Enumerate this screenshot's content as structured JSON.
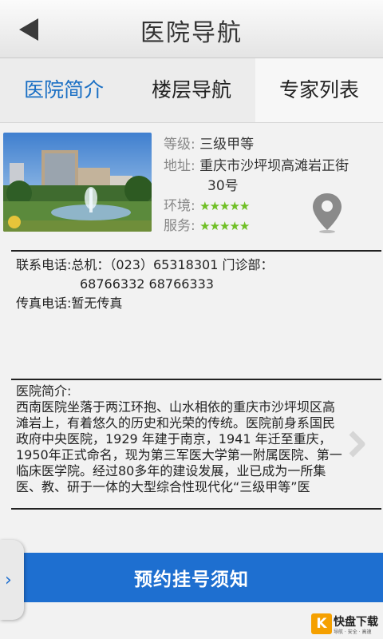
{
  "header": {
    "title": "医院导航"
  },
  "tabs": [
    {
      "label": "医院简介",
      "active": true
    },
    {
      "label": "楼层导航",
      "active": false
    },
    {
      "label": "专家列表",
      "active": false
    }
  ],
  "info": {
    "level_label": "等级:",
    "level_value": "三级甲等",
    "address_label": "地址:",
    "address_line1": "重庆市沙坪坝高滩岩正街",
    "address_line2": "30号",
    "environment_label": "环境:",
    "service_label": "服务:",
    "environment_rating": 5,
    "service_rating": 5
  },
  "contact": {
    "phone_label": "联系电话:",
    "phone_line1": "总机：（023）65318301 门诊部：",
    "phone_line2": "68766332      68766333",
    "fax_label": "传真电话:",
    "fax_value": "暂无传真"
  },
  "intro": {
    "heading": "医院简介:",
    "text": "西南医院坐落于两江环抱、山水相依的重庆市沙坪坝区高滩岩上，有着悠久的历史和光荣的传统。医院前身系国民政府中央医院，1929 年建于南京，1941 年迁至重庆，1950年正式命名，现为第三军医大学第一附属医院、第一临床医学院。经过80多年的建设发展，业已成为一所集医、教、研于一体的大型综合性现代化“三级甲等”医"
  },
  "bottom_button": {
    "label": "预约挂号须知"
  },
  "watermark": {
    "title": "快盘下载",
    "subtitle": "导航 · 安全 · 高速"
  },
  "colors": {
    "accent": "#1e6fd0",
    "tab_active": "#1a6fc4",
    "stars": "#6fbf24"
  }
}
